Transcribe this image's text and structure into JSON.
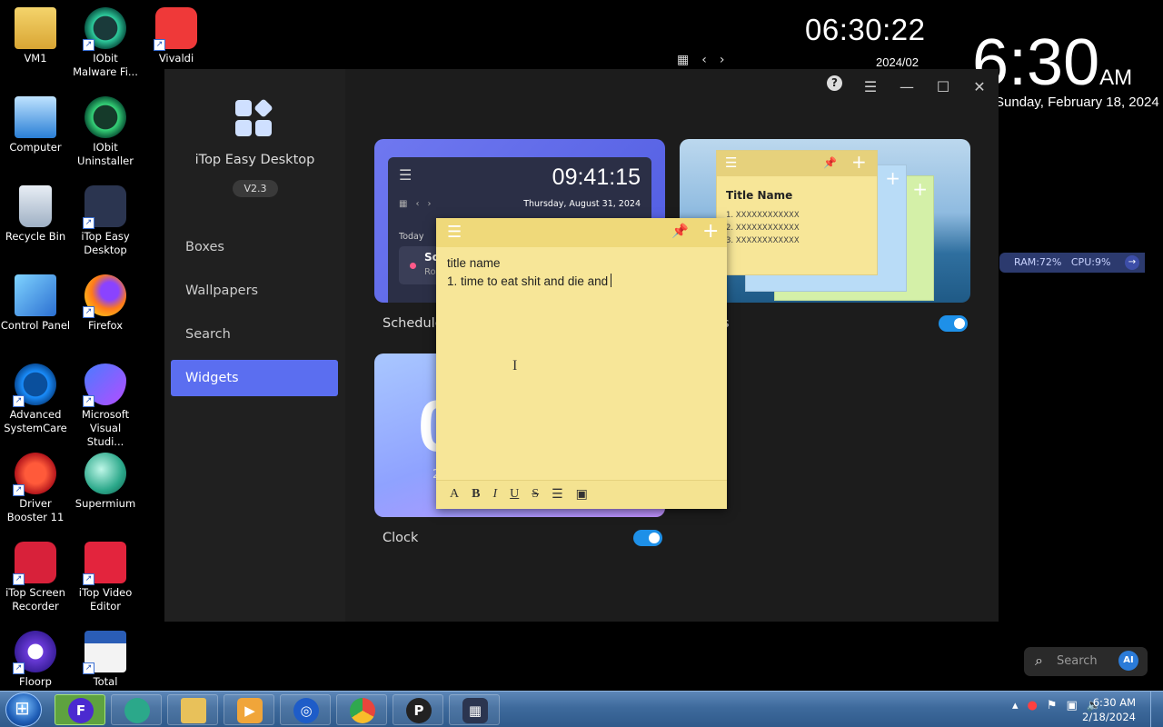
{
  "desktop_icons": [
    {
      "label": "VM1"
    },
    {
      "label": "IObit Malware Fi..."
    },
    {
      "label": "Vivaldi"
    },
    {
      "label": "Computer"
    },
    {
      "label": "IObit Uninstaller"
    },
    {
      "label": "Recycle Bin"
    },
    {
      "label": "iTop Easy Desktop"
    },
    {
      "label": "Control Panel"
    },
    {
      "label": "Firefox"
    },
    {
      "label": "Advanced SystemCare"
    },
    {
      "label": "Microsoft Visual Studi..."
    },
    {
      "label": "Driver Booster 11"
    },
    {
      "label": "Supermium"
    },
    {
      "label": "iTop Screen Recorder"
    },
    {
      "label": "iTop Video Editor"
    },
    {
      "label": "Floorp"
    },
    {
      "label": "Total"
    }
  ],
  "clock_widget_small": {
    "time": "06:30:22",
    "date": "2024/02"
  },
  "clock_widget_big": {
    "time": "6:30",
    "ampm": "AM",
    "date": "Sunday, February 18, 2024"
  },
  "system_monitor": {
    "ram": "RAM:72%",
    "cpu": "CPU:9%"
  },
  "app": {
    "name": "iTop Easy Desktop",
    "version": "V2.3",
    "nav": [
      {
        "label": "Boxes"
      },
      {
        "label": "Wallpapers"
      },
      {
        "label": "Search"
      },
      {
        "label": "Widgets"
      }
    ],
    "active_nav": "Widgets"
  },
  "widgets": {
    "schedule": {
      "label": "Schedule",
      "enabled": true,
      "preview_time": "09:41:15",
      "preview_date": "Thursday, August 31, 2024",
      "preview_today": "Today",
      "preview_event_title": "Sc",
      "preview_event_sub": "Ro"
    },
    "notes": {
      "label": "s",
      "enabled": true,
      "preview_title": "Title  Name",
      "preview_items": [
        "1. XXXXXXXXXXXX",
        "2. XXXXXXXXXXXX",
        "3. XXXXXXXXXXXX"
      ]
    },
    "clock": {
      "label": "Clock",
      "enabled": true,
      "preview_digit": "0",
      "preview_small": "2"
    }
  },
  "sticky_note": {
    "line1": "title name",
    "line2": "1. time to eat shit and die and",
    "format_buttons": [
      "A",
      "B",
      "I",
      "U",
      "S"
    ]
  },
  "desktop_search": {
    "placeholder": "Search",
    "ai_label": "AI"
  },
  "taskbar": {
    "apps": [
      {
        "name": "Floorp",
        "active": true
      },
      {
        "name": "Supermium"
      },
      {
        "name": "File Explorer"
      },
      {
        "name": "Media Player"
      },
      {
        "name": "Browser"
      },
      {
        "name": "Chrome"
      },
      {
        "name": "P app"
      },
      {
        "name": "iTop Easy Desktop"
      }
    ],
    "time": "6:30 AM",
    "date": "2/18/2024"
  }
}
